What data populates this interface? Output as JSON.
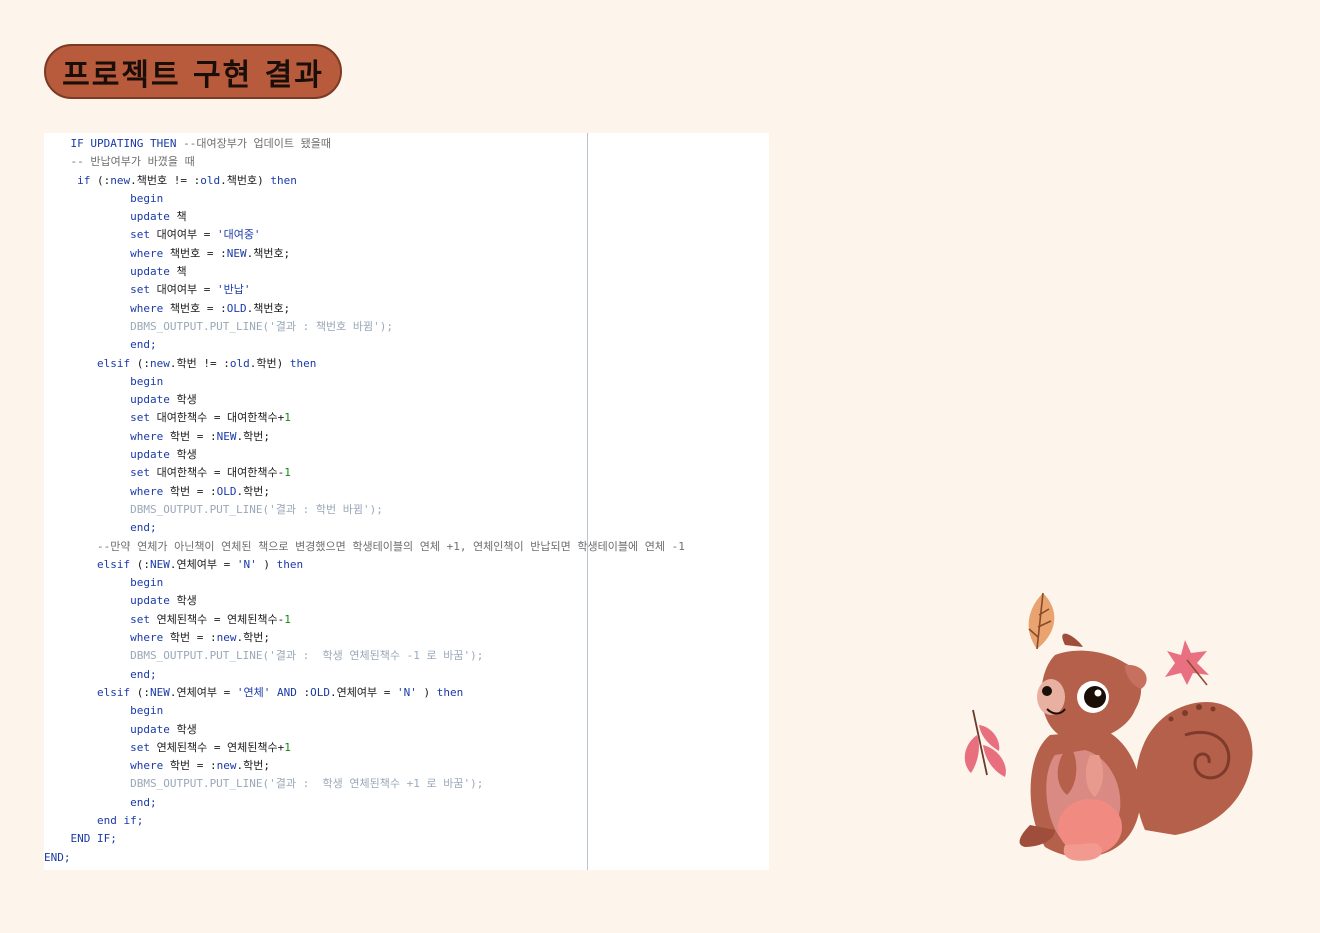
{
  "slide": {
    "title": "프로젝트 구현 결과"
  },
  "code": {
    "lines": [
      {
        "indent": "    ",
        "segments": [
          {
            "t": "IF UPDATING THEN",
            "c": "kw"
          },
          {
            "t": " --대여장부가 업데이트 됐을때",
            "c": "cm"
          }
        ]
      },
      {
        "indent": "    ",
        "segments": [
          {
            "t": "-- 반납여부가 바꼈을 때",
            "c": "cm"
          }
        ]
      },
      {
        "indent": "     ",
        "segments": [
          {
            "t": "if",
            "c": "kw"
          },
          {
            "t": " (:",
            "c": ""
          },
          {
            "t": "new",
            "c": "kw"
          },
          {
            "t": ".책번호 != :",
            "c": ""
          },
          {
            "t": "old",
            "c": "kw"
          },
          {
            "t": ".책번호) ",
            "c": ""
          },
          {
            "t": "then",
            "c": "kw"
          }
        ]
      },
      {
        "indent": "             ",
        "segments": [
          {
            "t": "begin",
            "c": "kw"
          }
        ]
      },
      {
        "indent": "             ",
        "segments": [
          {
            "t": "update",
            "c": "kw"
          },
          {
            "t": " 책",
            "c": ""
          }
        ]
      },
      {
        "indent": "             ",
        "segments": [
          {
            "t": "set",
            "c": "kw"
          },
          {
            "t": " 대여여부 = ",
            "c": ""
          },
          {
            "t": "'대여중'",
            "c": "str"
          }
        ]
      },
      {
        "indent": "             ",
        "segments": [
          {
            "t": "where",
            "c": "kw"
          },
          {
            "t": " 책번호 = :",
            "c": ""
          },
          {
            "t": "NEW",
            "c": "kw"
          },
          {
            "t": ".책번호;",
            "c": ""
          }
        ]
      },
      {
        "indent": "             ",
        "segments": [
          {
            "t": "update",
            "c": "kw"
          },
          {
            "t": " 책",
            "c": ""
          }
        ]
      },
      {
        "indent": "             ",
        "segments": [
          {
            "t": "set",
            "c": "kw"
          },
          {
            "t": " 대여여부 = ",
            "c": ""
          },
          {
            "t": "'반납'",
            "c": "str"
          }
        ]
      },
      {
        "indent": "             ",
        "segments": [
          {
            "t": "where",
            "c": "kw"
          },
          {
            "t": " 책번호 = :",
            "c": ""
          },
          {
            "t": "OLD",
            "c": "kw"
          },
          {
            "t": ".책번호;",
            "c": ""
          }
        ]
      },
      {
        "indent": "             ",
        "segments": [
          {
            "t": "DBMS_OUTPUT.PUT_LINE('결과 : 책번호 바뀜');",
            "c": "dim"
          }
        ]
      },
      {
        "indent": "             ",
        "segments": [
          {
            "t": "end;",
            "c": "kw"
          }
        ]
      },
      {
        "indent": "        ",
        "segments": [
          {
            "t": "elsif",
            "c": "kw"
          },
          {
            "t": " (:",
            "c": ""
          },
          {
            "t": "new",
            "c": "kw"
          },
          {
            "t": ".학번 != :",
            "c": ""
          },
          {
            "t": "old",
            "c": "kw"
          },
          {
            "t": ".학번) ",
            "c": ""
          },
          {
            "t": "then",
            "c": "kw"
          }
        ]
      },
      {
        "indent": "             ",
        "segments": [
          {
            "t": "begin",
            "c": "kw"
          }
        ]
      },
      {
        "indent": "             ",
        "segments": [
          {
            "t": "update",
            "c": "kw"
          },
          {
            "t": " 학생",
            "c": ""
          }
        ]
      },
      {
        "indent": "             ",
        "segments": [
          {
            "t": "set",
            "c": "kw"
          },
          {
            "t": " 대여한책수 = 대여한책수+",
            "c": ""
          },
          {
            "t": "1",
            "c": "num"
          }
        ]
      },
      {
        "indent": "             ",
        "segments": [
          {
            "t": "where",
            "c": "kw"
          },
          {
            "t": " 학번 = :",
            "c": ""
          },
          {
            "t": "NEW",
            "c": "kw"
          },
          {
            "t": ".학번;",
            "c": ""
          }
        ]
      },
      {
        "indent": "             ",
        "segments": [
          {
            "t": "update",
            "c": "kw"
          },
          {
            "t": " 학생",
            "c": ""
          }
        ]
      },
      {
        "indent": "             ",
        "segments": [
          {
            "t": "set",
            "c": "kw"
          },
          {
            "t": " 대여한책수 = 대여한책수-",
            "c": ""
          },
          {
            "t": "1",
            "c": "num"
          }
        ]
      },
      {
        "indent": "             ",
        "segments": [
          {
            "t": "where",
            "c": "kw"
          },
          {
            "t": " 학번 = :",
            "c": ""
          },
          {
            "t": "OLD",
            "c": "kw"
          },
          {
            "t": ".학번;",
            "c": ""
          }
        ]
      },
      {
        "indent": "             ",
        "segments": [
          {
            "t": "DBMS_OUTPUT.PUT_LINE('결과 : 학번 바뀜');",
            "c": "dim"
          }
        ]
      },
      {
        "indent": "             ",
        "segments": [
          {
            "t": "end;",
            "c": "kw"
          }
        ]
      },
      {
        "indent": "        ",
        "segments": [
          {
            "t": "--만약 연체가 아닌책이 연체된 책으로 변경했으면 학생테이블의 연체 +1, 연체인책이 반납되면 학생테이블에 연체 -1",
            "c": "cm"
          }
        ]
      },
      {
        "indent": "        ",
        "segments": [
          {
            "t": "elsif",
            "c": "kw"
          },
          {
            "t": " (:",
            "c": ""
          },
          {
            "t": "NEW",
            "c": "kw"
          },
          {
            "t": ".연체여부 = ",
            "c": ""
          },
          {
            "t": "'N'",
            "c": "str"
          },
          {
            "t": " ) ",
            "c": ""
          },
          {
            "t": "then",
            "c": "kw"
          }
        ]
      },
      {
        "indent": "             ",
        "segments": [
          {
            "t": "begin",
            "c": "kw"
          }
        ]
      },
      {
        "indent": "             ",
        "segments": [
          {
            "t": "update",
            "c": "kw"
          },
          {
            "t": " 학생",
            "c": ""
          }
        ]
      },
      {
        "indent": "             ",
        "segments": [
          {
            "t": "set",
            "c": "kw"
          },
          {
            "t": " 연체된책수 = 연체된책수-",
            "c": ""
          },
          {
            "t": "1",
            "c": "num"
          }
        ]
      },
      {
        "indent": "             ",
        "segments": [
          {
            "t": "where",
            "c": "kw"
          },
          {
            "t": " 학번 = :",
            "c": ""
          },
          {
            "t": "new",
            "c": "kw"
          },
          {
            "t": ".학번;",
            "c": ""
          }
        ]
      },
      {
        "indent": "             ",
        "segments": [
          {
            "t": "DBMS_OUTPUT.PUT_LINE('결과 :  학생 연체된책수 -1 로 바꿈');",
            "c": "dim"
          }
        ]
      },
      {
        "indent": "             ",
        "segments": [
          {
            "t": "end;",
            "c": "kw"
          }
        ]
      },
      {
        "indent": "        ",
        "segments": [
          {
            "t": "elsif",
            "c": "kw"
          },
          {
            "t": " (:",
            "c": ""
          },
          {
            "t": "NEW",
            "c": "kw"
          },
          {
            "t": ".연체여부 = ",
            "c": ""
          },
          {
            "t": "'연체'",
            "c": "str"
          },
          {
            "t": " ",
            "c": ""
          },
          {
            "t": "AND",
            "c": "kw"
          },
          {
            "t": " :",
            "c": ""
          },
          {
            "t": "OLD",
            "c": "kw"
          },
          {
            "t": ".연체여부 = ",
            "c": ""
          },
          {
            "t": "'N'",
            "c": "str"
          },
          {
            "t": " ) ",
            "c": ""
          },
          {
            "t": "then",
            "c": "kw"
          }
        ]
      },
      {
        "indent": "             ",
        "segments": [
          {
            "t": "begin",
            "c": "kw"
          }
        ]
      },
      {
        "indent": "             ",
        "segments": [
          {
            "t": "update",
            "c": "kw"
          },
          {
            "t": " 학생",
            "c": ""
          }
        ]
      },
      {
        "indent": "             ",
        "segments": [
          {
            "t": "set",
            "c": "kw"
          },
          {
            "t": " 연체된책수 = 연체된책수+",
            "c": ""
          },
          {
            "t": "1",
            "c": "num"
          }
        ]
      },
      {
        "indent": "             ",
        "segments": [
          {
            "t": "where",
            "c": "kw"
          },
          {
            "t": " 학번 = :",
            "c": ""
          },
          {
            "t": "new",
            "c": "kw"
          },
          {
            "t": ".학번;",
            "c": ""
          }
        ]
      },
      {
        "indent": "             ",
        "segments": [
          {
            "t": "DBMS_OUTPUT.PUT_LINE('결과 :  학생 연체된책수 +1 로 바꿈');",
            "c": "dim"
          }
        ]
      },
      {
        "indent": "             ",
        "segments": [
          {
            "t": "end;",
            "c": "kw"
          }
        ]
      },
      {
        "indent": "        ",
        "segments": [
          {
            "t": "end if;",
            "c": "kw"
          }
        ]
      },
      {
        "indent": "    ",
        "segments": [
          {
            "t": "END IF;",
            "c": "kw"
          }
        ]
      },
      {
        "indent": "",
        "segments": [
          {
            "t": "END;",
            "c": "kw"
          }
        ]
      }
    ]
  },
  "colors": {
    "background": "#fdf5ec",
    "title_pill": "#b85a3c",
    "keyword": "#1a3aa8",
    "comment": "#6d6d6d",
    "number": "#108a10"
  },
  "decoration": {
    "illustration": "squirrel-with-autumn-leaves"
  }
}
